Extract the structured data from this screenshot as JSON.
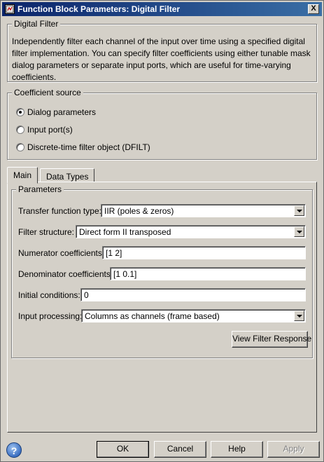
{
  "window": {
    "title": "Function Block Parameters: Digital Filter",
    "close_glyph": "X",
    "icon": "simulink-block-icon"
  },
  "header": {
    "group_title": "Digital Filter",
    "description": "Independently filter each channel of the input over time using a specified digital filter implementation. You can specify filter coefficients using either tunable mask dialog parameters or separate input ports, which are useful for time-varying coefficients."
  },
  "coefficient_source": {
    "group_title": "Coefficient source",
    "options": [
      {
        "label": "Dialog parameters",
        "checked": true
      },
      {
        "label": "Input port(s)",
        "checked": false
      },
      {
        "label": "Discrete-time filter object (DFILT)",
        "checked": false
      }
    ]
  },
  "tabs": [
    {
      "label": "Main",
      "active": true
    },
    {
      "label": "Data Types",
      "active": false
    }
  ],
  "parameters": {
    "group_title": "Parameters",
    "transfer_function_type": {
      "label": "Transfer function type:",
      "value": "IIR (poles & zeros)"
    },
    "filter_structure": {
      "label": "Filter structure:",
      "value": "Direct form II transposed"
    },
    "numerator": {
      "label": "Numerator coefficients:",
      "value": "[1 2]"
    },
    "denominator": {
      "label": "Denominator coefficients:",
      "value": "[1 0.1]"
    },
    "initial_conditions": {
      "label": "Initial conditions:",
      "value": "0"
    },
    "input_processing": {
      "label": "Input processing:",
      "value": "Columns as channels (frame based)"
    },
    "view_response_label": "View Filter Response"
  },
  "footer": {
    "help_glyph": "?",
    "ok_label": "OK",
    "cancel_label": "Cancel",
    "help_label": "Help",
    "apply_label": "Apply"
  }
}
